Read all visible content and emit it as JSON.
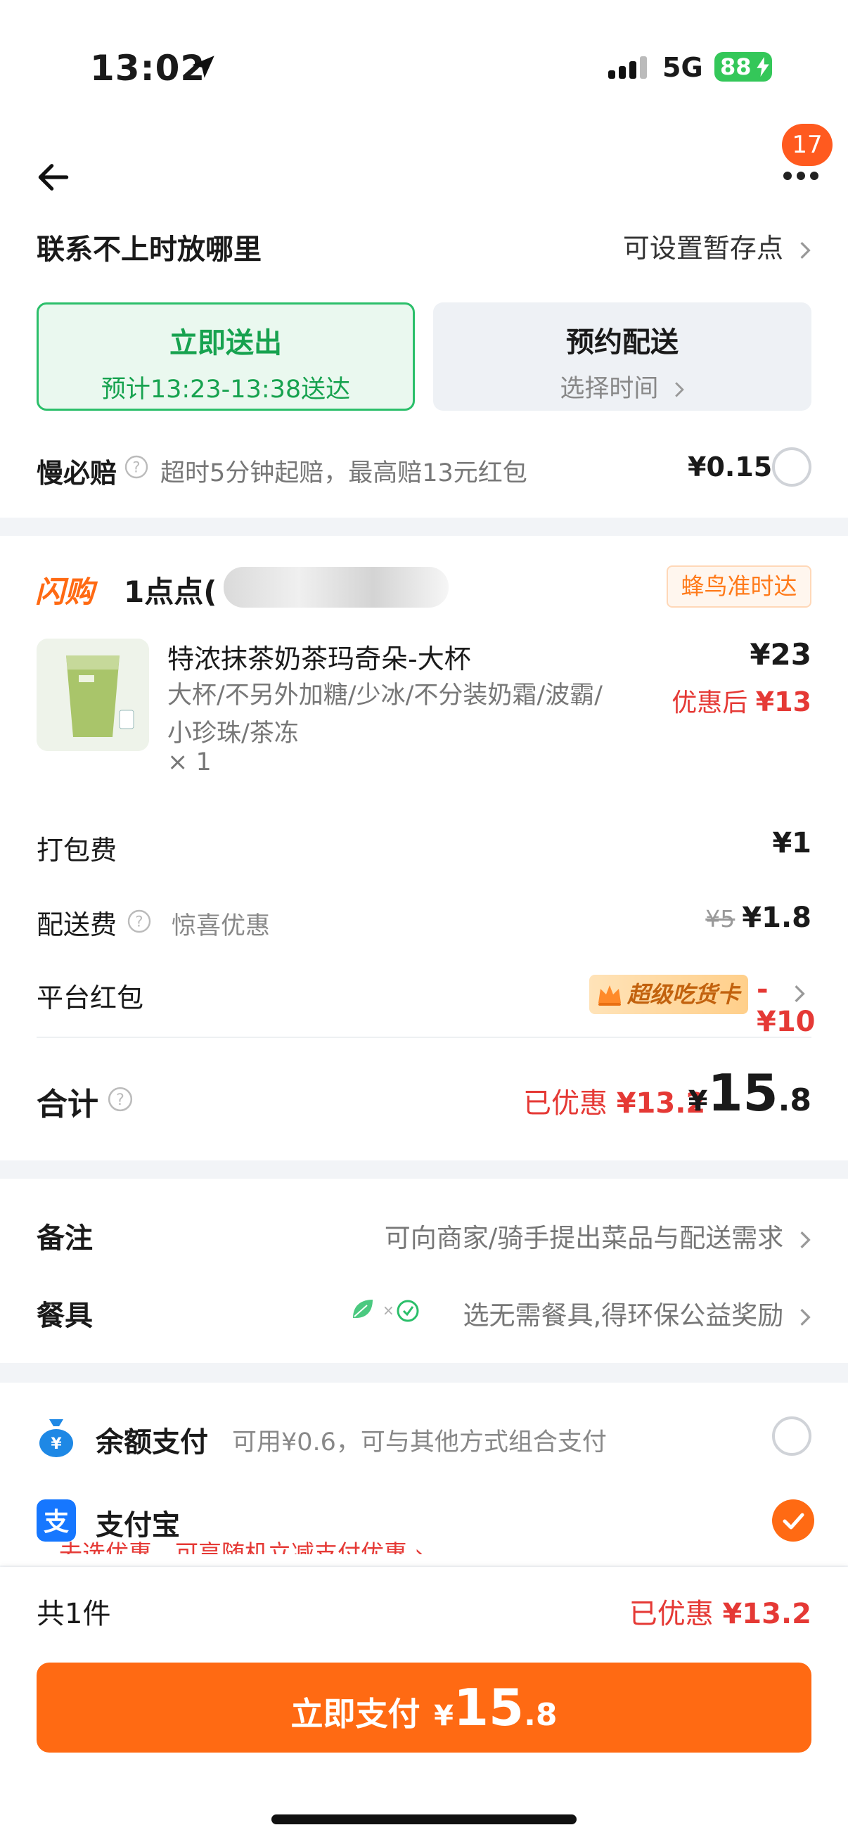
{
  "status_bar": {
    "time": "13:02",
    "network": "5G",
    "battery": "88",
    "colors": {
      "battery": "#34c759"
    }
  },
  "nav": {
    "badge_count": "17",
    "icons": [
      "back-arrow-icon",
      "more-dots-icon"
    ]
  },
  "contact": {
    "title": "联系不上时放哪里",
    "action": "可设置暂存点"
  },
  "delivery": {
    "now_title": "立即送出",
    "now_eta": "预计13:23-13:38送达",
    "later_title": "预约配送",
    "later_sub": "选择时间"
  },
  "slow_pay": {
    "title": "慢必赔",
    "desc": "超时5分钟起赔，最高赔13元红包",
    "price": "¥0.15"
  },
  "shop": {
    "brand": "闪购",
    "name": "1点点(",
    "tag": "蜂鸟准时达"
  },
  "product": {
    "name": "特浓抹茶奶茶玛奇朵-大杯",
    "options_line1": "大杯/不另外加糖/少冰/不分装奶霜/波霸/",
    "options_line2": "小珍珠/茶冻",
    "qty": "× 1",
    "price": "¥23",
    "discount_label": "优惠后",
    "discount_price": "¥13"
  },
  "fees": {
    "packing_label": "打包费",
    "packing_val": "¥1",
    "delivery_label": "配送费",
    "delivery_note": "惊喜优惠",
    "delivery_orig": "¥5",
    "delivery_val": "¥1.8",
    "redpack_label": "平台红包",
    "redpack_card": "超级吃货卡",
    "redpack_val": "-¥10"
  },
  "total": {
    "label": "合计",
    "saved_label": "已优惠",
    "saved_val": "¥13.2",
    "yen": "¥",
    "int": "15",
    "dec": ".8"
  },
  "extras": {
    "note_label": "备注",
    "note_val": "可向商家/骑手提出菜品与配送需求",
    "utensil_label": "餐具",
    "utensil_val": "选无需餐具,得环保公益奖励"
  },
  "payment": {
    "balance_name": "余额支付",
    "balance_desc": "可用¥0.6，可与其他方式组合支付",
    "alipay_name": "支付宝",
    "alipay_promo": "去选优惠，可享随机立减支付优惠 ›",
    "colors": {
      "alipay": "#1677ff",
      "balance": "#1e88e5"
    }
  },
  "bottom": {
    "count": "共1件",
    "saved_label": "已优惠",
    "saved_val": "¥13.2",
    "pay_label": "立即支付",
    "pay_yen": "¥",
    "pay_int": "15",
    "pay_dec": ".8",
    "colors": {
      "accent": "#ff6a13",
      "green": "#17a24f",
      "red": "#e53935"
    }
  }
}
